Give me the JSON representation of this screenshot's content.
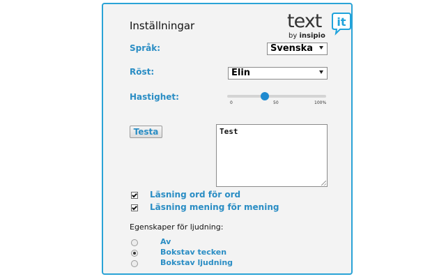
{
  "settings": {
    "title": "Inställningar",
    "logo": {
      "word": "text",
      "bubble": "it",
      "by_prefix": "by",
      "by_brand": "insipio"
    },
    "language": {
      "label": "Språk:",
      "value": "Svenska"
    },
    "voice": {
      "label": "Röst:",
      "value": "Elin"
    },
    "speed": {
      "label": "Hastighet:",
      "value_percent": 38,
      "ticks": [
        "0",
        "50",
        "100%"
      ]
    },
    "test_button": "Testa",
    "test_text": "Test",
    "checkboxes": [
      {
        "label": "Läsning ord för ord",
        "checked": true
      },
      {
        "label": "Läsning mening för mening",
        "checked": true
      }
    ],
    "sound_section_label": "Egenskaper för ljudning:",
    "sound_options": [
      {
        "label": "Av",
        "selected": false
      },
      {
        "label": "Bokstav tecken",
        "selected": true
      },
      {
        "label": "Bokstav ljudning",
        "selected": false
      }
    ],
    "colors": {
      "accent": "#2a8dc4",
      "border": "#2aa3d6",
      "slider_thumb": "#1f8ad0"
    },
    "icons": [
      "chevron-down-icon",
      "speech-bubble-icon",
      "resize-grip-icon"
    ]
  }
}
